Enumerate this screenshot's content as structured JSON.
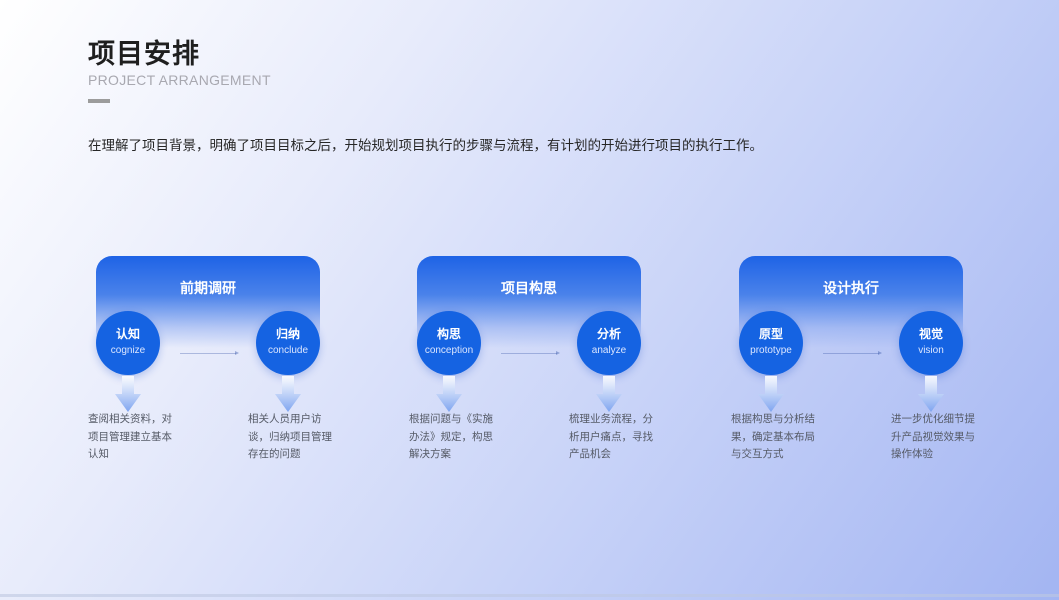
{
  "header": {
    "title": "项目安排",
    "subtitle": "PROJECT ARRANGEMENT",
    "intro": "在理解了项目背景，明确了项目目标之后，开始规划项目执行的步骤与流程，有计划的开始进行项目的执行工作。"
  },
  "phases": [
    {
      "label": "前期调研",
      "steps": [
        {
          "title": "认知",
          "en": "cognize",
          "desc": "查阅相关资料，对项目管理建立基本认知"
        },
        {
          "title": "归纳",
          "en": "conclude",
          "desc": "相关人员用户访谈，归纳项目管理存在的问题"
        }
      ]
    },
    {
      "label": "项目构思",
      "steps": [
        {
          "title": "构思",
          "en": "conception",
          "desc": "根据问题与《实施办法》规定，构思解决方案"
        },
        {
          "title": "分析",
          "en": "analyze",
          "desc": "梳理业务流程，分析用户痛点，寻找产品机会"
        }
      ]
    },
    {
      "label": "设计执行",
      "steps": [
        {
          "title": "原型",
          "en": "prototype",
          "desc": "根据构思与分析结果，确定基本布局与交互方式"
        },
        {
          "title": "视觉",
          "en": "vision",
          "desc": "进一步优化细节提升产品视觉效果与操作体验"
        }
      ]
    }
  ],
  "colors": {
    "primary": "#1563e2",
    "title_text": "#1f1f1f",
    "subtitle_text": "#a8a8b0",
    "desc_text": "#555a66"
  }
}
